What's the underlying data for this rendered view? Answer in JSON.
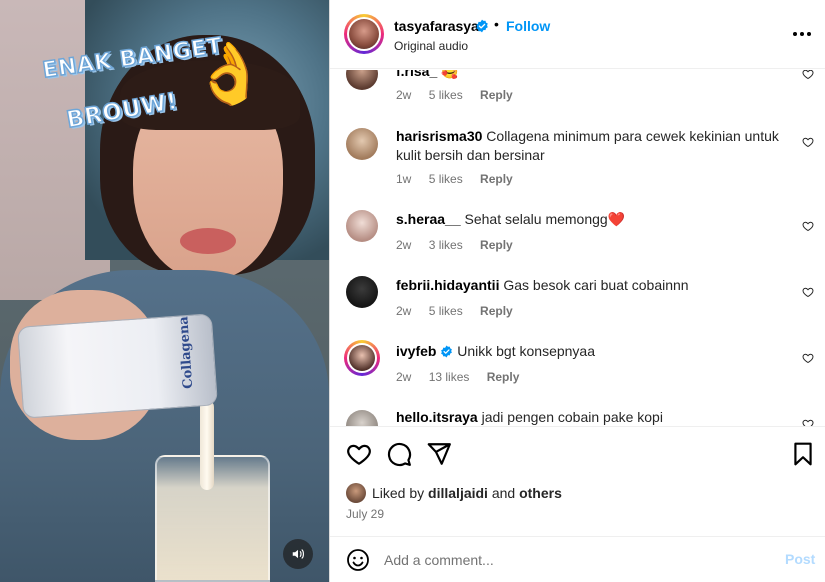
{
  "video": {
    "sticker_line1": "ENAK BANGET",
    "sticker_line2": "BROUW!",
    "can_label": "Collagena",
    "mute_icon": "speaker-icon"
  },
  "header": {
    "username": "tasyafarasya",
    "verified": true,
    "separator": "•",
    "follow_label": "Follow",
    "audio": "Original audio"
  },
  "comments": [
    {
      "username": "f.risa_",
      "text": "🥰",
      "time": "2w",
      "likes": "5 likes",
      "reply": "Reply"
    },
    {
      "username": "harisrisma30",
      "text": "Collagena minimum para cewek kekinian untuk kulit bersih dan bersinar",
      "time": "1w",
      "likes": "5 likes",
      "reply": "Reply"
    },
    {
      "username": "s.heraa__",
      "text": "Sehat selalu memongg❤️",
      "time": "2w",
      "likes": "3 likes",
      "reply": "Reply"
    },
    {
      "username": "febrii.hidayantii",
      "text": "Gas besok cari buat cobainnn",
      "time": "2w",
      "likes": "5 likes",
      "reply": "Reply"
    },
    {
      "username": "ivyfeb",
      "verified": true,
      "text": "Unikk bgt konsepnyaa",
      "time": "2w",
      "likes": "13 likes",
      "reply": "Reply"
    },
    {
      "username": "hello.itsraya",
      "text": "jadi pengen cobain pake kopi",
      "time": "",
      "likes": "",
      "reply": ""
    }
  ],
  "likes": {
    "prefix": "Liked by",
    "user": "dillaljaidi",
    "middle": "and",
    "others": "others"
  },
  "date": "July 29",
  "add_comment": {
    "placeholder": "Add a comment...",
    "post_label": "Post"
  },
  "colors": {
    "accent": "#0095f6",
    "post_disabled": "#b3dbff",
    "meta_gray": "#737373"
  }
}
